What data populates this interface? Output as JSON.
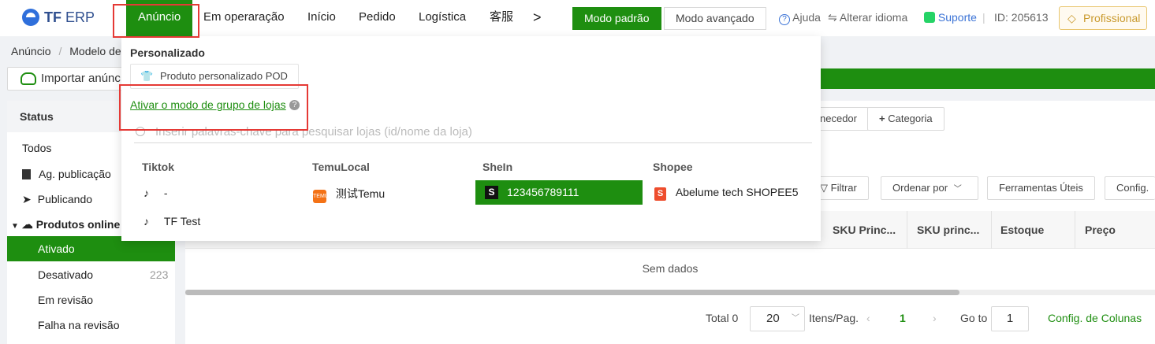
{
  "brand": {
    "logo_text": "TF",
    "logo_sub": "ERP"
  },
  "nav": {
    "items": [
      "Anúncio",
      "Em operaração",
      "Início",
      "Pedido",
      "Logística",
      "客服"
    ],
    "more": ">"
  },
  "modes": {
    "standard": "Modo padrão",
    "advanced": "Modo avançado"
  },
  "toolbar": {
    "help": "Ajuda",
    "language": "Alterar idioma",
    "support": "Suporte",
    "id": "ID: 205613",
    "plan": "Profissional"
  },
  "breadcrumb": {
    "first": "Anúncio",
    "sep": "/",
    "second": "Modelo de"
  },
  "import_button": "Importar anúnc",
  "sidebar": {
    "header": "Status",
    "items": [
      {
        "label": "Todos"
      },
      {
        "label": "Ag. publicação"
      },
      {
        "label": "Publicando"
      },
      {
        "label": "Produtos online"
      },
      {
        "label": "Ativado"
      },
      {
        "label": "Desativado",
        "count": "223"
      },
      {
        "label": "Em revisão"
      },
      {
        "label": "Falha na revisão"
      }
    ]
  },
  "filters": {
    "supplier": "necedor",
    "category": "Categoria"
  },
  "actions": {
    "filter": "Filtrar",
    "sort": "Ordenar por",
    "tools": "Ferramentas Úteis",
    "config": "Config."
  },
  "table": {
    "columns": [
      "SKU Princ...",
      "SKU princ...",
      "Estoque",
      "Preço"
    ],
    "empty": "Sem dados"
  },
  "pagination": {
    "total": "Total 0",
    "page_size": "20",
    "per_page": "Itens/Pag.",
    "current": "1",
    "goto_label": "Go to",
    "goto_value": "1",
    "columns_config": "Config. de Colunas"
  },
  "dropdown": {
    "section_title": "Personalizado",
    "pod_button": "Produto personalizado POD",
    "group_mode_link": "Ativar o modo de grupo de lojas",
    "search_placeholder": "Inserir palavras-chave para pesquisar lojas (id/nome da loja)",
    "platforms": [
      {
        "name": "Tiktok",
        "stores": [
          "-",
          "TF Test"
        ]
      },
      {
        "name": "TemuLocal",
        "stores": [
          "测试Temu"
        ]
      },
      {
        "name": "SheIn",
        "stores": [
          "123456789111"
        ]
      },
      {
        "name": "Shopee",
        "stores": [
          "Abelume tech SHOPEE5"
        ]
      }
    ]
  },
  "colors": {
    "accent": "#1e8e10",
    "highlight": "#e53935",
    "brand": "#2f6fdb"
  }
}
